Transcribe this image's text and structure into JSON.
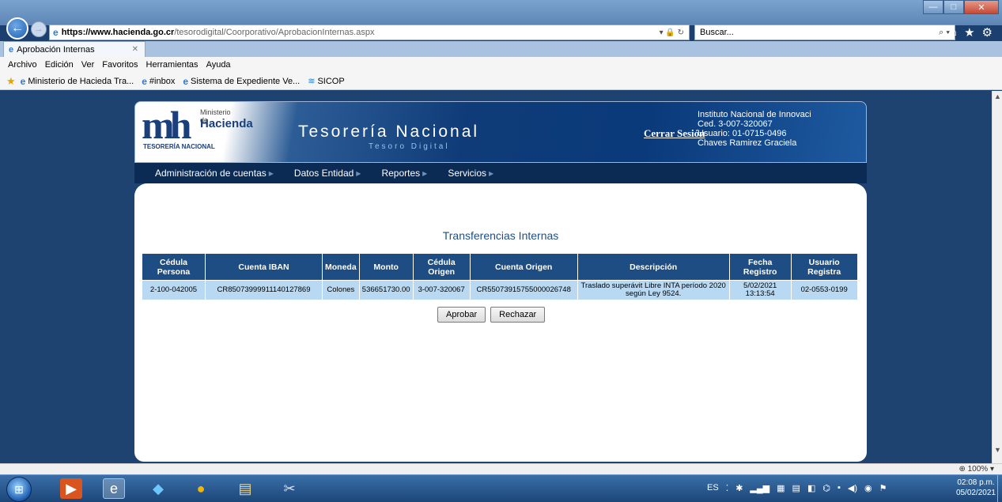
{
  "browser": {
    "url_protocol": "https://",
    "url_host": "www.hacienda.go.cr",
    "url_path": "/tesorodigital/Coorporativo/AprobacionInternas.aspx",
    "search_placeholder": "Buscar...",
    "tab_title": "Aprobación Internas",
    "menu": [
      "Archivo",
      "Edición",
      "Ver",
      "Favoritos",
      "Herramientas",
      "Ayuda"
    ],
    "favorites": [
      "Ministerio de Hacieda Tra...",
      "#inbox",
      "Sistema de Expediente Ve...",
      "SICOP"
    ],
    "zoom": "100%"
  },
  "site": {
    "logo_small": "Ministerio de",
    "logo_big": "Hacienda",
    "logo_sub": "TESORERÍA NACIONAL",
    "title": "Tesorería Nacional",
    "subtitle": "Tesoro Digital",
    "logout": "Cerrar Sesión",
    "user": {
      "institution": "Instituto Nacional de Innovaci",
      "ced": "Ced. 3-007-320067",
      "usuario": "Usuario: 01-0715-0496",
      "name": "Chaves Ramirez Graciela"
    },
    "nav": [
      "Administración de cuentas",
      "Datos Entidad",
      "Reportes",
      "Servicios"
    ]
  },
  "page": {
    "title": "Transferencias Internas",
    "table": {
      "headers": [
        "Cédula Persona",
        "Cuenta IBAN",
        "Moneda",
        "Monto",
        "Cédula Origen",
        "Cuenta Origen",
        "Descripción",
        "Fecha Registro",
        "Usuario Registra"
      ],
      "row": {
        "cedula": "2-100-042005",
        "iban": "CR85073999911140127869",
        "moneda": "Colones",
        "monto": "536651730.00",
        "cedula_origen": "3-007-320067",
        "cuenta_origen": "CR55073915755000026748",
        "descripcion": "Traslado superávit Libre INTA período 2020 según Ley 9524.",
        "fecha_registro": "5/02/2021 13:13:54",
        "usuario": "02-0553-0199"
      }
    },
    "approve": "Aprobar",
    "reject": "Rechazar"
  },
  "taskbar": {
    "lang": "ES",
    "time": "02:08 p.m.",
    "date": "05/02/2021"
  },
  "colors": {
    "header_dark": "#0a3a7a",
    "nav_bg": "#0b2b55",
    "table_header": "#1d4d82",
    "table_row": "#b9d9f2",
    "title_blue": "#1f4f86"
  }
}
